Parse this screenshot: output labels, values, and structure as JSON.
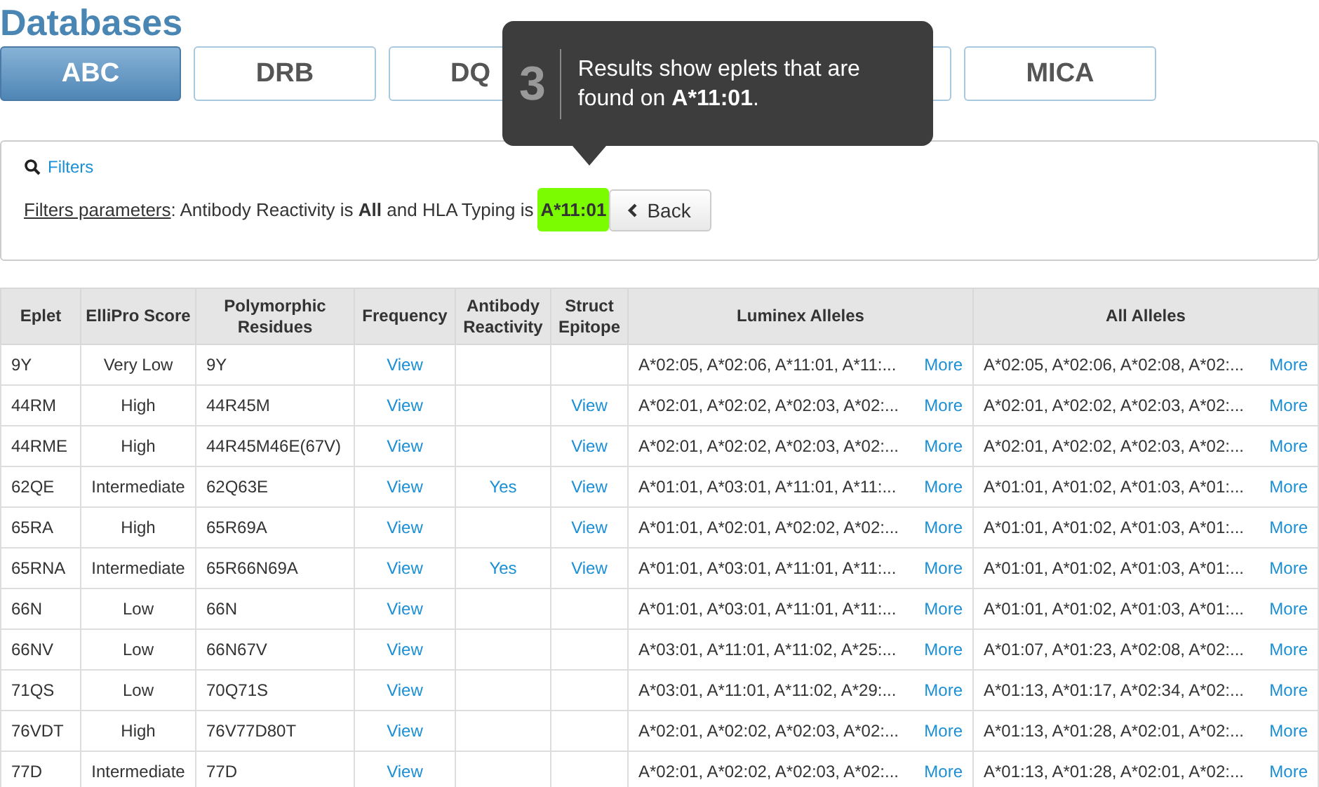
{
  "page_title": "Databases",
  "tabs": [
    {
      "label": "ABC",
      "selected": true
    },
    {
      "label": "DRB",
      "selected": false
    },
    {
      "label": "DQ",
      "selected": false
    },
    {
      "selected": false
    },
    {
      "label": "MICA",
      "selected": false
    }
  ],
  "tooltip": {
    "step": "3",
    "text": "Results show eplets that are found on **A*11:01**."
  },
  "filters": {
    "title": "Filters",
    "params_label": "Filters parameters",
    "params_text": ": Antibody Reactivity is **All** and HLA Typing is",
    "typing_badge": "A*11:01",
    "back_button": "Back"
  },
  "table": {
    "columns": [
      "Eplet",
      "ElliPro Score",
      "Polymorphic Residues",
      "Frequency",
      "Antibody Reactivity",
      "Struct Epitope",
      "Luminex Alleles",
      "All Alleles"
    ],
    "rows": [
      {
        "eplet": "9Y",
        "score": "Very Low",
        "residues": "9Y",
        "frequency": "View",
        "antibody": "",
        "struct": "",
        "luminex": "A*02:05, A*02:06, A*11:01, A*11:...",
        "luminex_more": "More",
        "all": "A*02:05, A*02:06, A*02:08, A*02:...",
        "all_more": "More"
      },
      {
        "eplet": "44RM",
        "score": "High",
        "residues": "44R45M",
        "frequency": "View",
        "antibody": "",
        "struct": "View",
        "luminex": "A*02:01, A*02:02, A*02:03, A*02:...",
        "luminex_more": "More",
        "all": "A*02:01, A*02:02, A*02:03, A*02:...",
        "all_more": "More"
      },
      {
        "eplet": "44RME",
        "score": "High",
        "residues": "44R45M46E(67V)",
        "frequency": "View",
        "antibody": "",
        "struct": "View",
        "luminex": "A*02:01, A*02:02, A*02:03, A*02:...",
        "luminex_more": "More",
        "all": "A*02:01, A*02:02, A*02:03, A*02:...",
        "all_more": "More"
      },
      {
        "eplet": "62QE",
        "score": "Intermediate",
        "residues": "62Q63E",
        "frequency": "View",
        "antibody": "Yes",
        "struct": "View",
        "luminex": "A*01:01, A*03:01, A*11:01, A*11:...",
        "luminex_more": "More",
        "all": "A*01:01, A*01:02, A*01:03, A*01:...",
        "all_more": "More"
      },
      {
        "eplet": "65RA",
        "score": "High",
        "residues": "65R69A",
        "frequency": "View",
        "antibody": "",
        "struct": "View",
        "luminex": "A*01:01, A*02:01, A*02:02, A*02:...",
        "luminex_more": "More",
        "all": "A*01:01, A*01:02, A*01:03, A*01:...",
        "all_more": "More"
      },
      {
        "eplet": "65RNA",
        "score": "Intermediate",
        "residues": "65R66N69A",
        "frequency": "View",
        "antibody": "Yes",
        "struct": "View",
        "luminex": "A*01:01, A*03:01, A*11:01, A*11:...",
        "luminex_more": "More",
        "all": "A*01:01, A*01:02, A*01:03, A*01:...",
        "all_more": "More"
      },
      {
        "eplet": "66N",
        "score": "Low",
        "residues": "66N",
        "frequency": "View",
        "antibody": "",
        "struct": "",
        "luminex": "A*01:01, A*03:01, A*11:01, A*11:...",
        "luminex_more": "More",
        "all": "A*01:01, A*01:02, A*01:03, A*01:...",
        "all_more": "More"
      },
      {
        "eplet": "66NV",
        "score": "Low",
        "residues": "66N67V",
        "frequency": "View",
        "antibody": "",
        "struct": "",
        "luminex": "A*03:01, A*11:01, A*11:02, A*25:...",
        "luminex_more": "More",
        "all": "A*01:07, A*01:23, A*02:08, A*02:...",
        "all_more": "More"
      },
      {
        "eplet": "71QS",
        "score": "Low",
        "residues": "70Q71S",
        "frequency": "View",
        "antibody": "",
        "struct": "",
        "luminex": "A*03:01, A*11:01, A*11:02, A*29:...",
        "luminex_more": "More",
        "all": "A*01:13, A*01:17, A*02:34, A*02:...",
        "all_more": "More"
      },
      {
        "eplet": "76VDT",
        "score": "High",
        "residues": "76V77D80T",
        "frequency": "View",
        "antibody": "",
        "struct": "",
        "luminex": "A*02:01, A*02:02, A*02:03, A*02:...",
        "luminex_more": "More",
        "all": "A*01:13, A*01:28, A*02:01, A*02:...",
        "all_more": "More"
      },
      {
        "eplet": "77D",
        "score": "Intermediate",
        "residues": "77D",
        "frequency": "View",
        "antibody": "",
        "struct": "",
        "luminex": "A*02:01, A*02:02, A*02:03, A*02:...",
        "luminex_more": "More",
        "all": "A*01:13, A*01:28, A*02:01, A*02:...",
        "all_more": "More"
      }
    ]
  }
}
